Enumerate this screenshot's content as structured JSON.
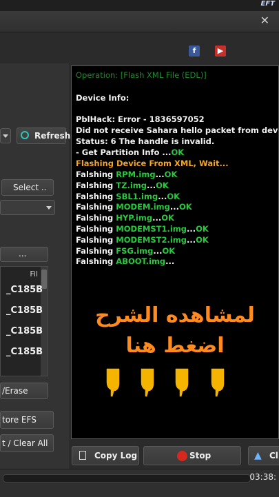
{
  "brand": "EFT",
  "social": {
    "facebook": "f",
    "youtube": "▶"
  },
  "left": {
    "refresh_label": "Refresh",
    "select_label": "Select ..",
    "dots_label": "...",
    "list_header": "Fil",
    "list_items": [
      "_C185B",
      "_C185B",
      "_C185B",
      "_C185B"
    ],
    "erase_label": "/Erase",
    "restore_label": "tore EFS",
    "clear_label": "t / Clear All"
  },
  "console": {
    "operation": "Operation: [Flash XML File (EDL)]",
    "device_info": "Device Info:",
    "error": "PblHack: Error - 1836597052",
    "sahara": "Did not receive Sahara hello packet from device",
    "status": "Status: 6 The handle is invalid.",
    "partition_prefix": " - Get Partition Info ...",
    "ok": "OK",
    "flashing_xml": "Flashing Device From XML, Wait...",
    "falshing": "Falshing",
    "files": [
      {
        "name": "RPM.img",
        "ok": "OK"
      },
      {
        "name": "TZ.img",
        "ok": "OK"
      },
      {
        "name": "SBL1.img",
        "ok": "OK"
      },
      {
        "name": "MODEM.img",
        "ok": "OK"
      },
      {
        "name": "HYP.img",
        "ok": "OK"
      },
      {
        "name": "MODEMST1.img",
        "ok": "OK"
      },
      {
        "name": "MODEMST2.img",
        "ok": "OK"
      },
      {
        "name": "FSG.img",
        "ok": "OK"
      },
      {
        "name": "ABOOT.img",
        "ok": ""
      }
    ],
    "overlay_line1": "لمشاهده الشرح",
    "overlay_line2": "اضغط هنا"
  },
  "bottom": {
    "copy_log": "Copy Log",
    "stop": "Stop",
    "clear": "Cl"
  },
  "status": {
    "time": "03:38:"
  },
  "colors": {
    "ok": "#27c93f",
    "highlight": "#f5a623",
    "overlay": "#ff8a1e",
    "hand": "#f5b400"
  }
}
